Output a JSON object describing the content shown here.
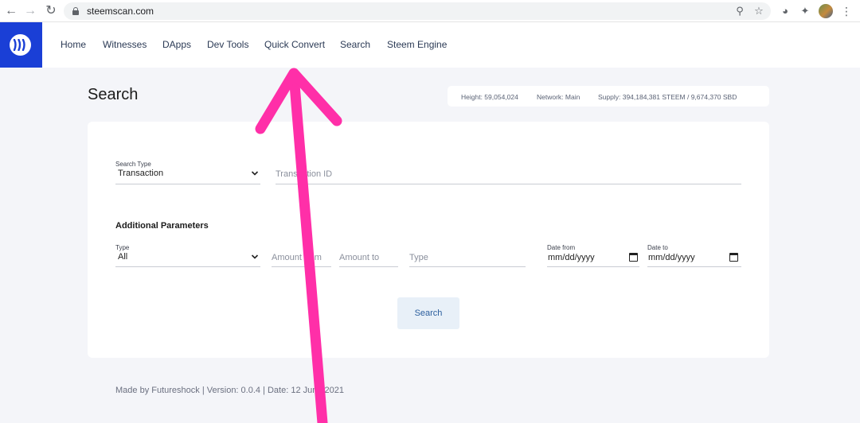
{
  "browser": {
    "url": "steemscan.com",
    "icons": {
      "back": "arrow-left-icon",
      "forward": "arrow-right-icon",
      "reload": "reload-icon",
      "lock": "lock-icon",
      "zoom": "zoom-icon",
      "bookmark": "star-icon",
      "extensions": [
        "compass-icon",
        "puzzle-icon"
      ],
      "profile": "profile-avatar",
      "menu": "kebab-menu-icon"
    }
  },
  "header": {
    "brand_color": "#1a3fd6",
    "logo": "steem-logo-icon",
    "nav": [
      "Home",
      "Witnesses",
      "DApps",
      "Dev Tools",
      "Quick Convert",
      "Search",
      "Steem Engine"
    ]
  },
  "page": {
    "title": "Search",
    "stats": {
      "height": "Height: 59,054,024",
      "network": "Network: Main",
      "supply": "Supply: 394,184,381 STEEM / 9,674,370 SBD"
    }
  },
  "search_form": {
    "search_type_label": "Search Type",
    "search_type_value": "Transaction",
    "transaction_id_placeholder": "Transaction ID",
    "additional_title": "Additional Parameters",
    "type_label": "Type",
    "type_value": "All",
    "amount_from_placeholder": "Amount from",
    "amount_to_placeholder": "Amount to",
    "type_text_placeholder": "Type",
    "date_from_label": "Date from",
    "date_from_value": "mm/dd/yyyy",
    "date_to_label": "Date to",
    "date_to_value": "mm/dd/yyyy",
    "search_button": "Search",
    "button_color": "#e8f0f8"
  },
  "footer": {
    "text": "Made by Futureshock |  Version: 0.0.4 | Date: 12 June 2021"
  },
  "annotation": {
    "type": "arrow",
    "color": "#ff2fa8",
    "points_to": "Quick Convert"
  }
}
